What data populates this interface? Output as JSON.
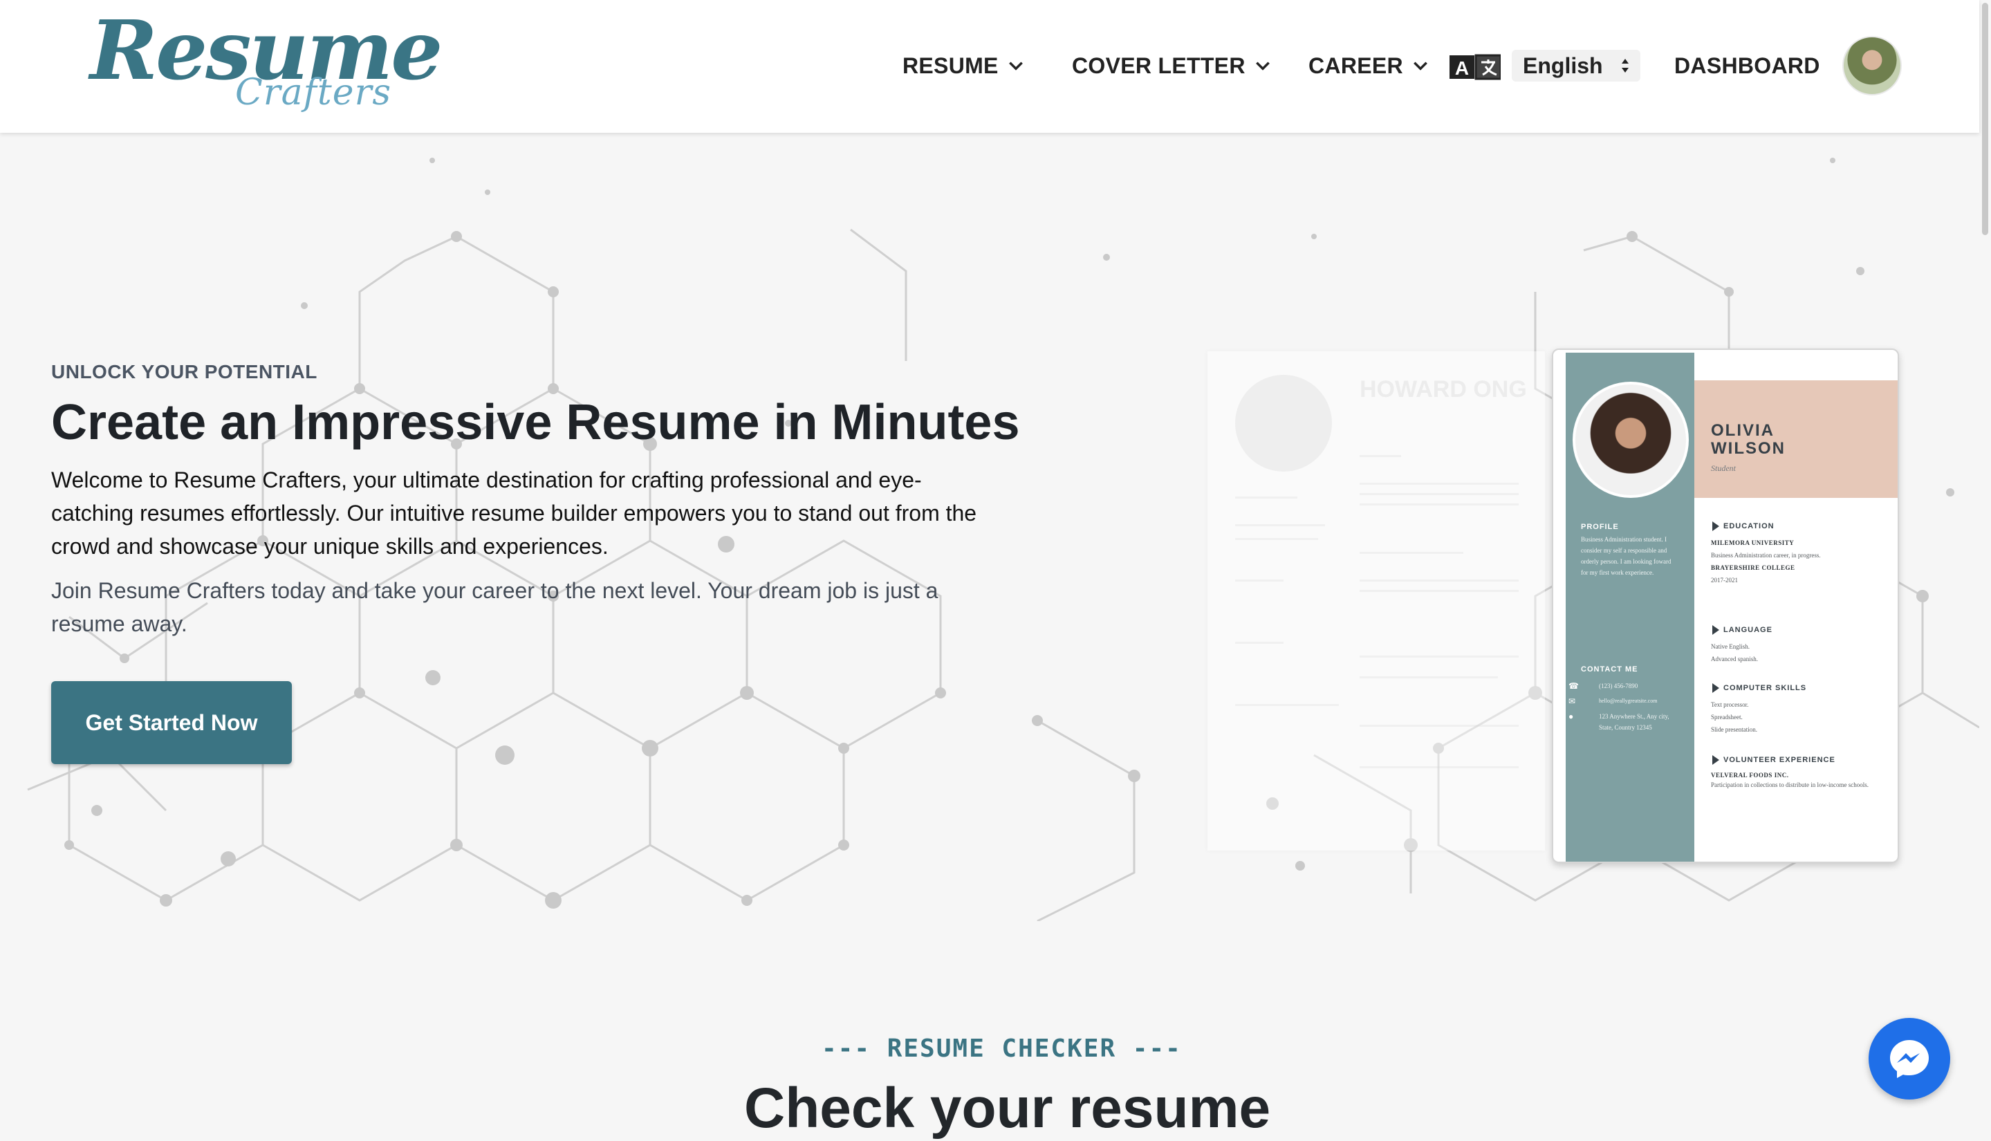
{
  "header": {
    "logo_main": "Resume",
    "logo_sub": "Crafters",
    "nav": {
      "resume": "RESUME",
      "cover_letter": "COVER LETTER",
      "career": "CAREER",
      "dashboard": "DASHBOARD"
    },
    "language": "English"
  },
  "hero": {
    "eyebrow": "UNLOCK YOUR POTENTIAL",
    "title": "Create an Impressive Resume in Minutes",
    "paragraph1": "Welcome to Resume Crafters, your ultimate destination for crafting professional and eye-catching resumes effortlessly. Our intuitive resume builder empowers you to stand out from the crowd and showcase your unique skills and experiences.",
    "paragraph2": "Join Resume Crafters today and take your career to the next level. Your dream job is just a resume away.",
    "cta": "Get Started Now"
  },
  "ghost_resume": {
    "name": "HOWARD ONG"
  },
  "resume_preview": {
    "name_line1": "OLIVIA",
    "name_line2": "WILSON",
    "role": "Student",
    "profile_heading": "PROFILE",
    "profile_text": "Business Administration student. I consider my self a responsible and orderly person. I am looking foward for my first work experience.",
    "contact_heading": "CONTACT ME",
    "phone": "(123) 456-7890",
    "email": "hello@reallygreatsite.com",
    "address": "123 Anywhere St., Any city, State, Country 12345",
    "education_heading": "EDUCATION",
    "edu1_school": "MILEMORA UNIVERSITY",
    "edu1_desc": "Business Administration career, in progress.",
    "edu2_school": "BRAYERSHIRE COLLEGE",
    "edu2_years": "2017-2021",
    "language_heading": "LANGUAGE",
    "lang1": "Native English.",
    "lang2": "Advanced spanish.",
    "skills_heading": "COMPUTER SKILLS",
    "skill1": "Text processor.",
    "skill2": "Spreadsheet.",
    "skill3": "Slide presentation.",
    "volunteer_heading": "VOLUNTEER EXPERIENCE",
    "vol_org": "VELVERAL FOODS INC.",
    "vol_desc": "Participation in collections to distribute in low-income schools."
  },
  "checker": {
    "label": "--- RESUME CHECKER ---",
    "title": "Check your resume"
  },
  "colors": {
    "brand": "#3b7483",
    "brand_light": "#6aa9c4",
    "resume_side": "#7fa0a2",
    "resume_band": "#e6c8b8",
    "messenger": "#1f6fe8"
  },
  "icons": [
    "chevron-down-icon",
    "translate-icon",
    "select-arrows-icon",
    "messenger-icon",
    "phone-icon",
    "mail-icon",
    "location-icon"
  ]
}
